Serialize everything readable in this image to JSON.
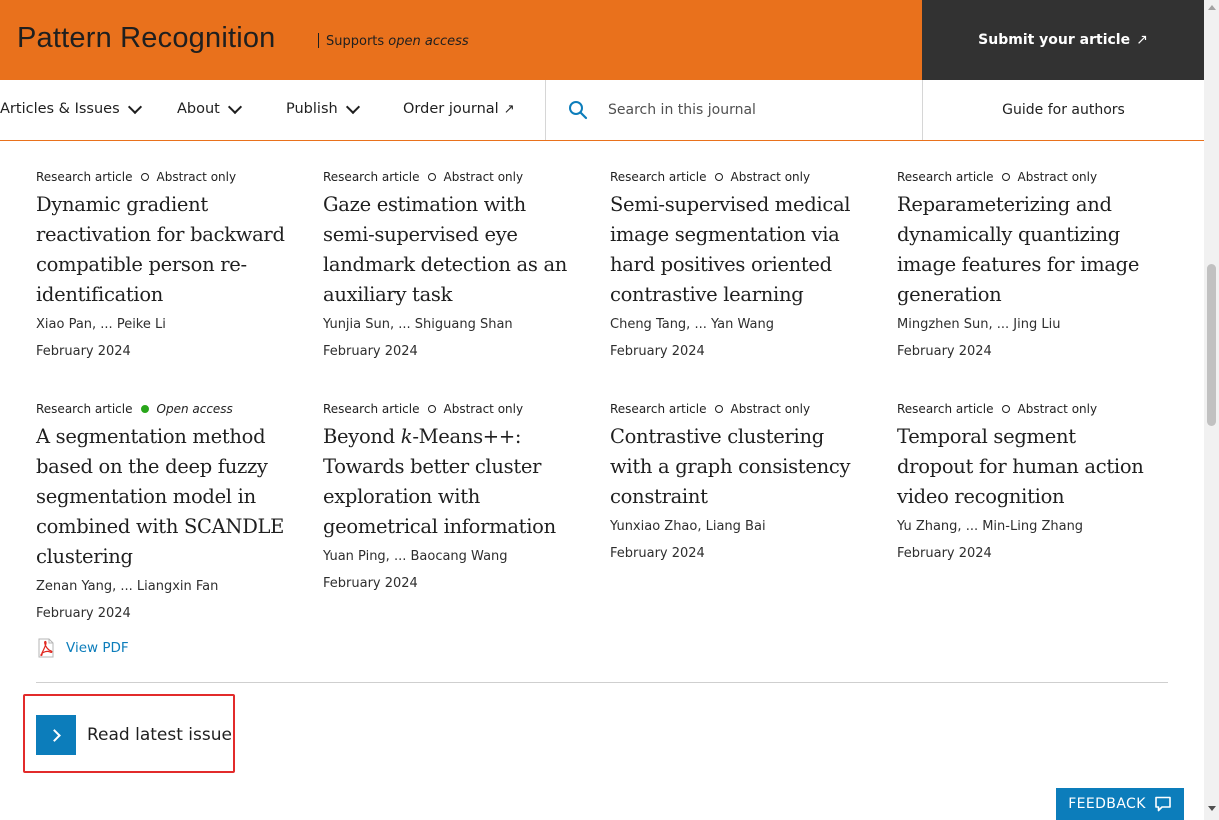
{
  "header": {
    "journal_title": "Pattern Recognition",
    "supports_prefix": "Supports ",
    "supports_emphasis": "open access",
    "submit_label": "Submit your article",
    "submit_icon": "arrow-up-right-icon",
    "brand_color": "#e9711c",
    "submit_bg": "#323232"
  },
  "nav": {
    "items": [
      {
        "label": "Articles & Issues",
        "icon": "chevron-down-icon"
      },
      {
        "label": "About",
        "icon": "chevron-down-icon"
      },
      {
        "label": "Publish",
        "icon": "chevron-down-icon"
      },
      {
        "label": "Order journal",
        "icon": "arrow-up-right-icon"
      }
    ],
    "search_placeholder": "Search in this journal",
    "guide_label": "Guide for authors"
  },
  "articles": [
    {
      "type": "Research article",
      "access": "Abstract only",
      "title": "Dynamic gradient reactivation for backward compatible person re-identification",
      "authors": "Xiao Pan, ... Peike Li",
      "date": "February 2024"
    },
    {
      "type": "Research article",
      "access": "Abstract only",
      "title": "Gaze estimation with semi-supervised eye landmark detection as an auxiliary task",
      "authors": "Yunjia Sun, ... Shiguang Shan",
      "date": "February 2024"
    },
    {
      "type": "Research article",
      "access": "Abstract only",
      "title": "Semi-supervised medical image segmentation via hard positives oriented contrastive learning",
      "authors": "Cheng Tang, ... Yan Wang",
      "date": "February 2024"
    },
    {
      "type": "Research article",
      "access": "Abstract only",
      "title": "Reparameterizing and dynamically quantizing image features for image generation",
      "authors": "Mingzhen Sun, ... Jing Liu",
      "date": "February 2024"
    },
    {
      "type": "Research article",
      "access": "Open access",
      "title": "A segmentation method based on the deep fuzzy segmentation model in combined with SCANDLE clustering",
      "authors": "Zenan Yang, ... Liangxin Fan",
      "date": "February 2024",
      "pdf_label": "View PDF"
    },
    {
      "type": "Research article",
      "access": "Abstract only",
      "title_prefix": "Beyond ",
      "title_italic": "k",
      "title_suffix": "-Means++: Towards better cluster exploration with geometrical information",
      "authors": "Yuan Ping, ... Baocang Wang",
      "date": "February 2024"
    },
    {
      "type": "Research article",
      "access": "Abstract only",
      "title": "Contrastive clustering with a graph consistency constraint",
      "authors": "Yunxiao Zhao, Liang Bai",
      "date": "February 2024"
    },
    {
      "type": "Research article",
      "access": "Abstract only",
      "title": "Temporal segment dropout for human action video recognition",
      "authors": "Yu Zhang, ... Min-Ling Zhang",
      "date": "February 2024"
    }
  ],
  "read_latest_label": "Read latest issue",
  "feedback_label": "FEEDBACK",
  "colors": {
    "link_blue": "#0c7dbb",
    "open_access_green": "#29a61b",
    "highlight_red": "#e22b2b"
  }
}
